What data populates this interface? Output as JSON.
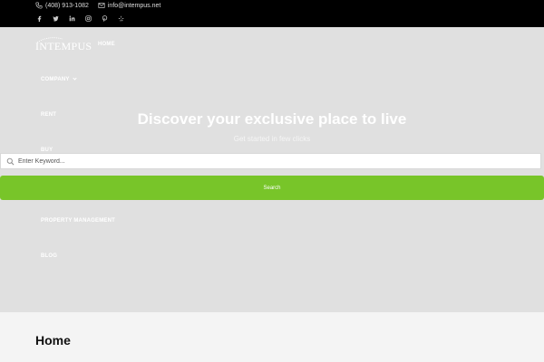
{
  "topbar": {
    "phone": "(408) 913-1082",
    "email": "info@intempus.net",
    "social": [
      "facebook-icon",
      "twitter-icon",
      "linkedin-icon",
      "instagram-icon",
      "pinterest-icon",
      "yelp-icon"
    ]
  },
  "header": {
    "logo_text": "INTEMPUS",
    "nav": [
      {
        "label": "HOME",
        "has_dropdown": false
      },
      {
        "label": "COMPANY",
        "has_dropdown": true
      },
      {
        "label": "RENT",
        "has_dropdown": false
      },
      {
        "label": "BUY",
        "has_dropdown": false
      },
      {
        "label": "PROPERTY MANAGEMENT",
        "has_dropdown": false
      },
      {
        "label": "BLOG",
        "has_dropdown": false
      }
    ]
  },
  "hero": {
    "title": "Discover your exclusive place to live",
    "subtitle": "Get started in few clicks",
    "search_placeholder": "Enter Keyword...",
    "search_button": "Search"
  },
  "main": {
    "page_title": "Home"
  },
  "colors": {
    "topbar_bg": "#000000",
    "hero_bg": "#e0e0e0",
    "accent_green": "#78c529"
  }
}
